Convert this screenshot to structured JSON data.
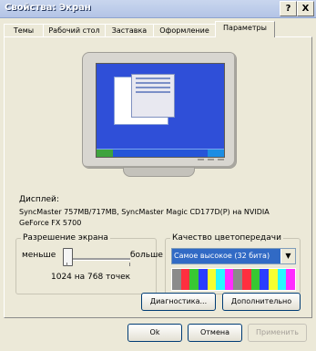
{
  "window": {
    "title": "Свойства: Экран",
    "help_button": "?",
    "close_button": "X"
  },
  "tabs": [
    "Темы",
    "Рабочий стол",
    "Заставка",
    "Оформление",
    "Параметры"
  ],
  "display": {
    "label": "Дисплей:",
    "value_line_1": "SyncMaster 757MB/717MB, SyncMaster Magic CD177D(P) на NVIDIA",
    "value_line_2": "GeForce FX 5700"
  },
  "resolution": {
    "group_label": "Разрешение экрана",
    "less_label": "меньше",
    "more_label": "больше",
    "value_label": "1024 на 768 точек",
    "slider_level": 0.0
  },
  "color_quality": {
    "group_label": "Качество цветопередачи",
    "selected": "Самое высокое (32 бита)",
    "spectrum_colors": [
      "#8b8b8b",
      "#ff2f3f",
      "#38c832",
      "#2a3dff",
      "#f6ff2f",
      "#29f6ff",
      "#ff2cff",
      "#8b8b8b",
      "#ff2f3f",
      "#38c832",
      "#2a3dff",
      "#f6ff2f",
      "#29f6ff",
      "#ff2cff"
    ]
  },
  "buttons": {
    "diagnostics": "Диагностика...",
    "advanced": "Дополнительно",
    "ok": "Ok",
    "cancel": "Отмена",
    "apply": "Применить"
  }
}
